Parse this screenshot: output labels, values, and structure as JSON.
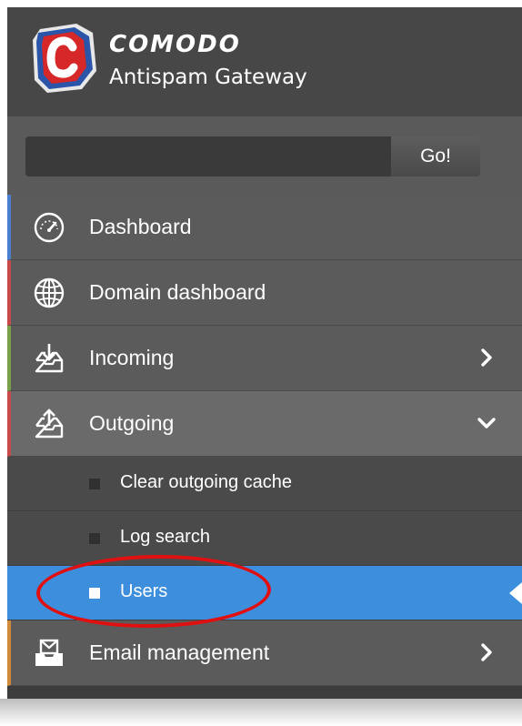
{
  "brand": {
    "name": "COMODO",
    "product": "Antispam Gateway"
  },
  "search": {
    "value": "",
    "placeholder": "",
    "button_label": "Go!"
  },
  "nav": {
    "items": [
      {
        "label": "Dashboard",
        "icon": "speedometer-icon",
        "accent": "#4a7fd0"
      },
      {
        "label": "Domain dashboard",
        "icon": "globe-icon",
        "accent": "#c84a4a"
      },
      {
        "label": "Incoming",
        "icon": "inbox-download-icon",
        "accent": "#7aa04a",
        "chevron": "chevron-right-icon"
      },
      {
        "label": "Outgoing",
        "icon": "outbox-upload-icon",
        "accent": "#c84a4a",
        "chevron": "chevron-down-icon",
        "expanded": true
      },
      {
        "label": "Email management",
        "icon": "envelope-tray-icon",
        "accent": "#d08a3a",
        "chevron": "chevron-right-icon"
      }
    ],
    "outgoing_sub": [
      {
        "label": "Clear outgoing cache"
      },
      {
        "label": "Log search"
      },
      {
        "label": "Users",
        "active": true
      }
    ]
  },
  "colors": {
    "sidebar_bg": "#5b5b5b",
    "header_bg": "#474747",
    "active_bg": "#3d8fdd",
    "annotation_red": "#e01010"
  }
}
